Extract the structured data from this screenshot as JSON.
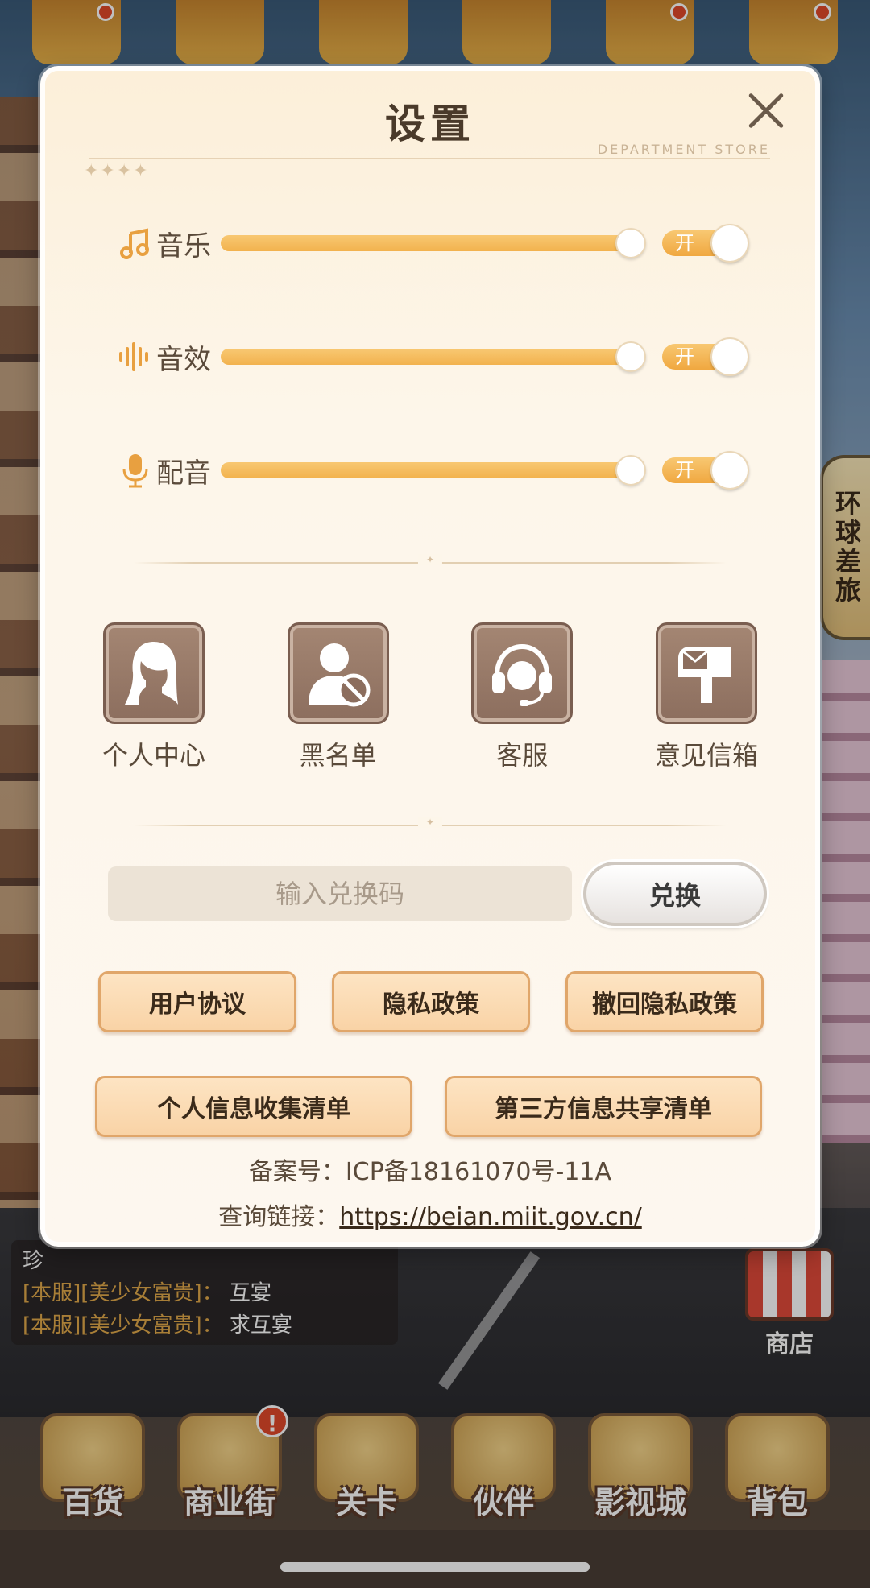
{
  "background": {
    "side_tab_label": "环球差旅",
    "chat": [
      {
        "line": "珍"
      },
      {
        "server": "[本服]",
        "name": "[美少女富贵]",
        "sep": "：",
        "msg": "互宴"
      },
      {
        "server": "[本服]",
        "name": "[美少女富贵]",
        "sep": "：",
        "msg": "求互宴"
      }
    ],
    "store_label": "商店",
    "bottom_nav": [
      {
        "label": "百货",
        "icon": "department-store-icon"
      },
      {
        "label": "商业街",
        "icon": "business-street-icon",
        "alert": "!"
      },
      {
        "label": "关卡",
        "icon": "truck-icon"
      },
      {
        "label": "伙伴",
        "icon": "chef-partner-icon"
      },
      {
        "label": "影视城",
        "icon": "film-camera-icon"
      },
      {
        "label": "背包",
        "icon": "bag-icon"
      }
    ]
  },
  "settings": {
    "title": "设置",
    "subtitle": "DEPARTMENT STORE",
    "stars": "✦✦✦✦",
    "rows": [
      {
        "label": "音乐",
        "icon": "music-note-icon",
        "volume": 1.0,
        "toggle": "开",
        "on": true
      },
      {
        "label": "音效",
        "icon": "sound-wave-icon",
        "volume": 1.0,
        "toggle": "开",
        "on": true
      },
      {
        "label": "配音",
        "icon": "microphone-icon",
        "volume": 1.0,
        "toggle": "开",
        "on": true
      }
    ],
    "shortcuts": [
      {
        "label": "个人中心",
        "icon": "profile-icon"
      },
      {
        "label": "黑名单",
        "icon": "blacklist-icon"
      },
      {
        "label": "客服",
        "icon": "headset-icon"
      },
      {
        "label": "意见信箱",
        "icon": "mailbox-icon"
      }
    ],
    "redeem": {
      "placeholder": "输入兑换码",
      "button": "兑换"
    },
    "links": [
      "用户协议",
      "隐私政策",
      "撤回隐私政策",
      "个人信息收集清单",
      "第三方信息共享清单"
    ],
    "icp_label": "备案号：ICP备18161070号-11A",
    "query_label": "查询链接：",
    "query_url": "https://beian.miit.gov.cn/"
  },
  "colors": {
    "accent": "#f2b24e",
    "panel": "#fdf6ea",
    "text": "#5a4a3a"
  }
}
